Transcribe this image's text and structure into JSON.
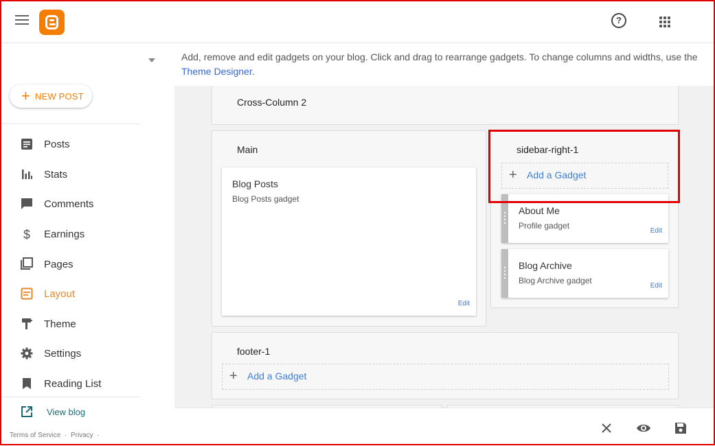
{
  "header": {
    "menu_icon": "hamburger-menu-icon",
    "logo": "blogger-logo",
    "help_glyph": "?",
    "apps_icon": "apps-grid-icon"
  },
  "sidebar": {
    "new_post_plus": "+",
    "new_post_label": "NEW POST",
    "items": [
      {
        "label": "Posts",
        "icon": "posts-icon"
      },
      {
        "label": "Stats",
        "icon": "stats-icon"
      },
      {
        "label": "Comments",
        "icon": "comments-icon"
      },
      {
        "label": "Earnings",
        "icon": "earnings-icon"
      },
      {
        "label": "Pages",
        "icon": "pages-icon"
      },
      {
        "label": "Layout",
        "icon": "layout-icon",
        "active": true
      },
      {
        "label": "Theme",
        "icon": "theme-icon"
      },
      {
        "label": "Settings",
        "icon": "settings-icon"
      },
      {
        "label": "Reading List",
        "icon": "reading-list-icon"
      }
    ],
    "view_blog": "View blog",
    "terms": "Terms of Service",
    "separator": "·",
    "privacy": "Privacy",
    "trailing_dot": "·"
  },
  "info": {
    "text": "Add, remove and edit gadgets on your blog. Click and drag to rearrange gadgets. To change columns and widths, use the ",
    "link": "Theme Designer",
    "end": "."
  },
  "layout": {
    "cross_column": {
      "title": "Cross-Column 2"
    },
    "main": {
      "title": "Main",
      "gadgets": [
        {
          "title": "Blog Posts",
          "subtitle": "Blog Posts gadget",
          "edit": "Edit"
        }
      ]
    },
    "sidebar_right": {
      "title": "sidebar-right-1",
      "add_plus": "+",
      "add_label": "Add a Gadget",
      "gadgets": [
        {
          "title": "About Me",
          "subtitle": "Profile gadget",
          "edit": "Edit"
        },
        {
          "title": "Blog Archive",
          "subtitle": "Blog Archive gadget",
          "edit": "Edit"
        }
      ]
    },
    "footer": {
      "title": "footer-1",
      "add_plus": "+",
      "add_label": "Add a Gadget"
    }
  },
  "actions": {
    "close_icon": "close-icon",
    "preview_icon": "eye-icon",
    "save_icon": "save-icon"
  },
  "colors": {
    "accent": "#f57d00",
    "active_nav": "#e5892b",
    "link": "#3d7fd6",
    "highlight": "#e00000"
  }
}
